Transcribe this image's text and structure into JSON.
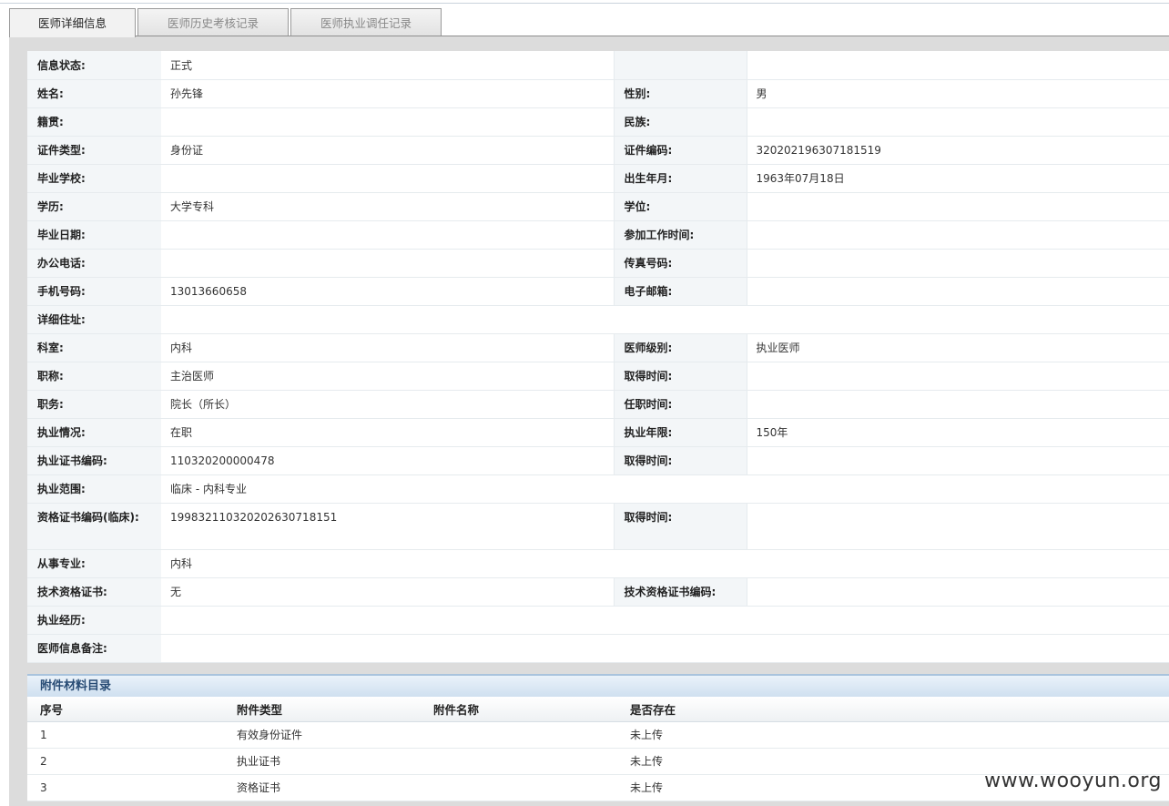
{
  "tabs": [
    {
      "label": "医师详细信息",
      "active": true
    },
    {
      "label": "医师历史考核记录",
      "active": false
    },
    {
      "label": "医师执业调任记录",
      "active": false
    }
  ],
  "detail": {
    "info_status_label": "信息状态:",
    "info_status": "正式",
    "name_label": "姓名:",
    "name": "孙先锋",
    "gender_label": "性别:",
    "gender": "男",
    "native_place_label": "籍贯:",
    "native_place": "",
    "ethnicity_label": "民族:",
    "ethnicity": "",
    "id_type_label": "证件类型:",
    "id_type": "身份证",
    "id_number_label": "证件编码:",
    "id_number": "320202196307181519",
    "school_label": "毕业学校:",
    "school": "",
    "birth_label": "出生年月:",
    "birth": "1963年07月18日",
    "education_label": "学历:",
    "education": "大学专科",
    "degree_label": "学位:",
    "degree": "",
    "grad_date_label": "毕业日期:",
    "grad_date": "",
    "work_start_label": "参加工作时间:",
    "work_start": "",
    "office_phone_label": "办公电话:",
    "office_phone": "",
    "fax_label": "传真号码:",
    "fax": "",
    "mobile_label": "手机号码:",
    "mobile": "13013660658",
    "email_label": "电子邮箱:",
    "email": "",
    "address_label": "详细住址:",
    "address": "",
    "department_label": "科室:",
    "department": "内科",
    "physician_level_label": "医师级别:",
    "physician_level": "执业医师",
    "title_label": "职称:",
    "title": "主治医师",
    "title_date_label": "取得时间:",
    "title_date": "",
    "position_label": "职务:",
    "position": "院长（所长）",
    "position_date_label": "任职时间:",
    "position_date": "",
    "practice_status_label": "执业情况:",
    "practice_status": "在职",
    "practice_years_label": "执业年限:",
    "practice_years": "150年",
    "license_no_label": "执业证书编码:",
    "license_no": "110320200000478",
    "license_date_label": "取得时间:",
    "license_date": "",
    "practice_scope_label": "执业范围:",
    "practice_scope": "临床 - 内科专业",
    "qualification_no_label": "资格证书编码(临床):",
    "qualification_no": "199832110320202630718151",
    "qualification_date_label": "取得时间:",
    "qualification_date": "",
    "specialty_label": "从事专业:",
    "specialty": "内科",
    "tech_cert_label": "技术资格证书:",
    "tech_cert": "无",
    "tech_cert_no_label": "技术资格证书编码:",
    "tech_cert_no": "",
    "experience_label": "执业经历:",
    "experience": "",
    "remarks_label": "医师信息备注:",
    "remarks": ""
  },
  "attachments": {
    "title": "附件材料目录",
    "columns": [
      "序号",
      "附件类型",
      "附件名称",
      "是否存在"
    ],
    "rows": [
      {
        "no": "1",
        "type": "有效身份证件",
        "name": "",
        "exists": "未上传"
      },
      {
        "no": "2",
        "type": "执业证书",
        "name": "",
        "exists": "未上传"
      },
      {
        "no": "3",
        "type": "资格证书",
        "name": "",
        "exists": "未上传"
      }
    ]
  },
  "watermark": "www.wooyun.org"
}
